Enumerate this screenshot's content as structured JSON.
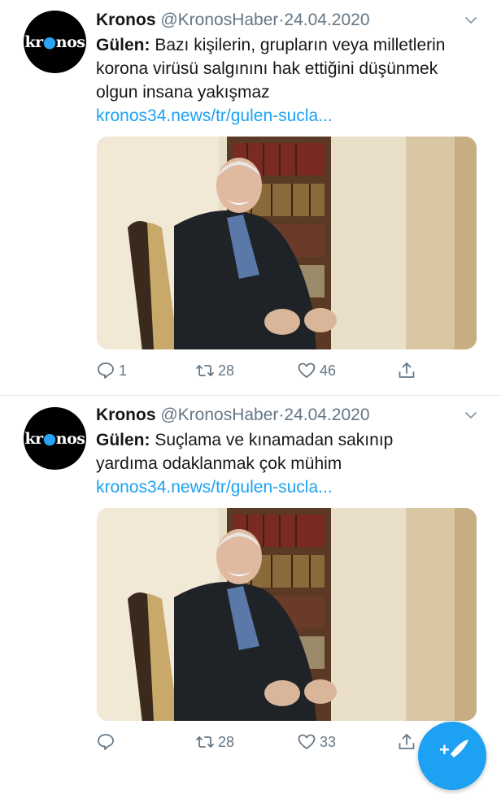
{
  "tweets": [
    {
      "avatar_text": "kr",
      "avatar_text_after": "nos",
      "name": "Kronos",
      "handle": "@KronosHaber",
      "separator": "·",
      "date": "24.04.2020",
      "speaker": "Gülen:",
      "text_line1": "Bazı kişilerin, grupların veya milletlerin",
      "text_line2": "korona virüsü salgınını hak ettiğini düşünmek",
      "text_line3": "olgun insana yakışmaz",
      "link": "kronos34.news/tr/gulen-sucla...",
      "reply_count": "1",
      "retweet_count": "28",
      "like_count": "46"
    },
    {
      "avatar_text": "kr",
      "avatar_text_after": "nos",
      "name": "Kronos",
      "handle": "@KronosHaber",
      "separator": "·",
      "date": "24.04.2020",
      "speaker": "Gülen:",
      "text_line1": "Suçlama ve kınamadan sakınıp",
      "text_line2": "yardıma odaklanmak çok mühim",
      "link": "kronos34.news/tr/gulen-sucla...",
      "reply_count": "",
      "retweet_count": "28",
      "like_count": "33"
    }
  ],
  "colors": {
    "accent": "#1da1f2",
    "muted": "#657786",
    "text": "#14171a"
  },
  "icons": [
    "reply-icon",
    "retweet-icon",
    "like-icon",
    "share-icon",
    "chevron-down-icon",
    "compose-icon"
  ]
}
